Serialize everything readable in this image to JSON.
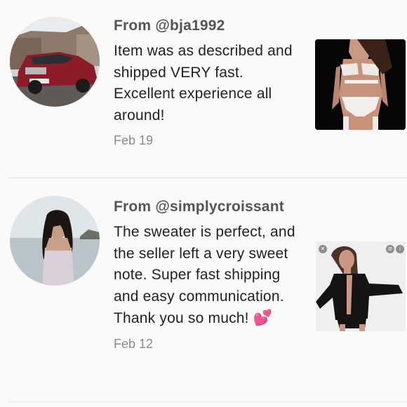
{
  "reviews": [
    {
      "from": "From @bja1992",
      "text": "Item was as described and shipped VERY fast. Excellent experience all around!",
      "date": "Feb 19",
      "avatar_icon": "car-photo",
      "thumb_icon": "lingerie-photo"
    },
    {
      "from": "From @simplycroissant",
      "text": "The sweater is perfect, and the seller left a very sweet note. Super fast shipping and easy communication. Thank you so much!",
      "emoji": "💕",
      "date": "Feb 12",
      "avatar_icon": "beach-portrait-photo",
      "thumb_icon": "lace-up-top-photo"
    }
  ],
  "colors": {
    "background": "#fafafa",
    "from_text": "#555555",
    "body_text": "#222222",
    "date_text": "#8a8a8a",
    "heart": "#ff3d8e"
  }
}
